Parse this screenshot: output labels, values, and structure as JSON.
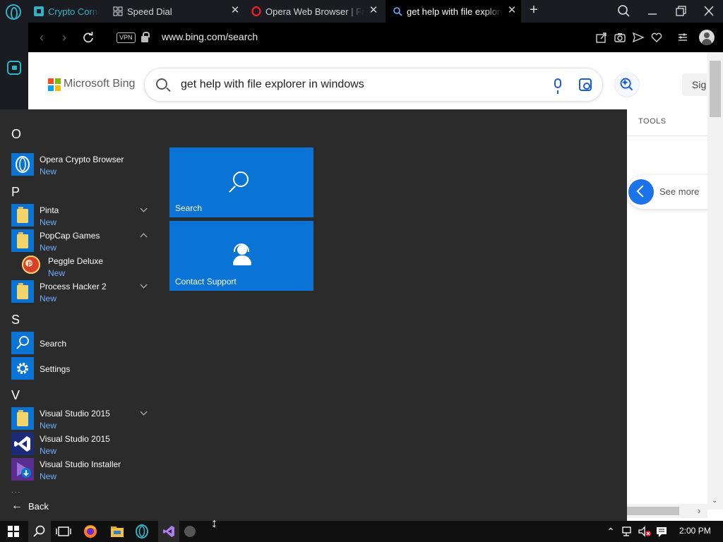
{
  "tabs": [
    {
      "label": "Crypto Corner",
      "color": "#2fb3c8"
    },
    {
      "label": "Speed Dial"
    },
    {
      "label": "Opera Web Browser | Faster"
    },
    {
      "label": "get help with file explorer",
      "active": true
    }
  ],
  "tab_close_glyph": "✕",
  "new_tab_glyph": "+",
  "address": {
    "vpn_label": "VPN",
    "url": "www.bing.com/search"
  },
  "bing": {
    "logo_text": "Microsoft Bing",
    "logo_colors": [
      "#f25022",
      "#7fba00",
      "#00a4ef",
      "#ffb900"
    ],
    "query": "get help with file explorer in windows",
    "signin_label": "Sig",
    "tools_label": "TOOLS",
    "see_more_label": "See more"
  },
  "start_menu": {
    "sections": [
      {
        "letter": "O"
      },
      {
        "letter": "P"
      },
      {
        "letter": "S"
      },
      {
        "letter": "V"
      }
    ],
    "apps": [
      {
        "name": "Opera Crypto Browser",
        "sub": "New"
      },
      {
        "name": "Pinta",
        "sub": "New"
      },
      {
        "name": "PopCap Games",
        "sub": "New"
      },
      {
        "name": "Peggle Deluxe",
        "sub": "New"
      },
      {
        "name": "Process Hacker 2",
        "sub": "New"
      },
      {
        "name": "Search"
      },
      {
        "name": "Settings"
      },
      {
        "name": "Visual Studio 2015",
        "sub": "New"
      },
      {
        "name": "Visual Studio 2015",
        "sub": "New"
      },
      {
        "name": "Visual Studio Installer",
        "sub": "New"
      }
    ],
    "dots": "...",
    "back_label": "Back",
    "tiles": [
      {
        "label": "Search"
      },
      {
        "label": "Contact Support"
      }
    ],
    "accent": "#0a74d6"
  },
  "taskbar": {
    "time": "2:00 PM"
  }
}
